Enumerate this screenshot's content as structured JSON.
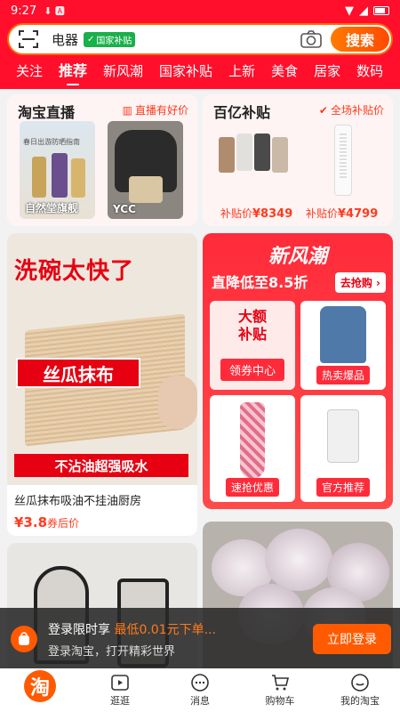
{
  "status": {
    "time": "9:27"
  },
  "search": {
    "keyword": "电器",
    "tag": "国家补贴",
    "button": "搜索"
  },
  "tabs": [
    "关注",
    "推荐",
    "新风潮",
    "国家补贴",
    "上新",
    "美食",
    "居家",
    "数码"
  ],
  "live": {
    "title": "淘宝直播",
    "subtitle": "直播有好价",
    "items": [
      {
        "label": "自然堂旗舰",
        "banner": "春日出游防晒指南"
      },
      {
        "label": "YCC"
      }
    ]
  },
  "subsidy": {
    "title": "百亿补贴",
    "subtitle": "全场补贴价",
    "items": [
      {
        "price_label": "补贴价",
        "price": "¥8349"
      },
      {
        "price_label": "补贴价",
        "price": "¥4799"
      }
    ]
  },
  "product": {
    "image_text_top": "洗碗太快了",
    "image_text_mid": "丝瓜抹布",
    "image_text_bottom": "不沾油超强吸水",
    "title": "丝瓜抹布吸油不挂油厨房",
    "price": "¥3.8",
    "price_suffix": "券后价"
  },
  "fashion": {
    "title": "新风潮",
    "subtitle": "直降低至8.5折",
    "button": "去抢购 ›",
    "cells": [
      {
        "big_text_1": "大额",
        "big_text_2": "补贴",
        "pill": "领券中心"
      },
      {
        "pill": "热卖爆品"
      },
      {
        "pill": "速抢优惠"
      },
      {
        "pill": "官方推荐"
      }
    ]
  },
  "login": {
    "line1_prefix": "登录限时享",
    "line1_highlight": "最低0.01元下单...",
    "line2": "登录淘宝，打开精彩世界",
    "button": "立即登录"
  },
  "nav": [
    {
      "label": "淘",
      "icon": "taobao-logo-icon"
    },
    {
      "label": "逛逛",
      "icon": "play-icon"
    },
    {
      "label": "消息",
      "icon": "message-icon"
    },
    {
      "label": "购物车",
      "icon": "cart-icon"
    },
    {
      "label": "我的淘宝",
      "icon": "smile-icon"
    }
  ],
  "colors": {
    "brand": "#ff0f2c",
    "accent": "#ff5a00"
  }
}
